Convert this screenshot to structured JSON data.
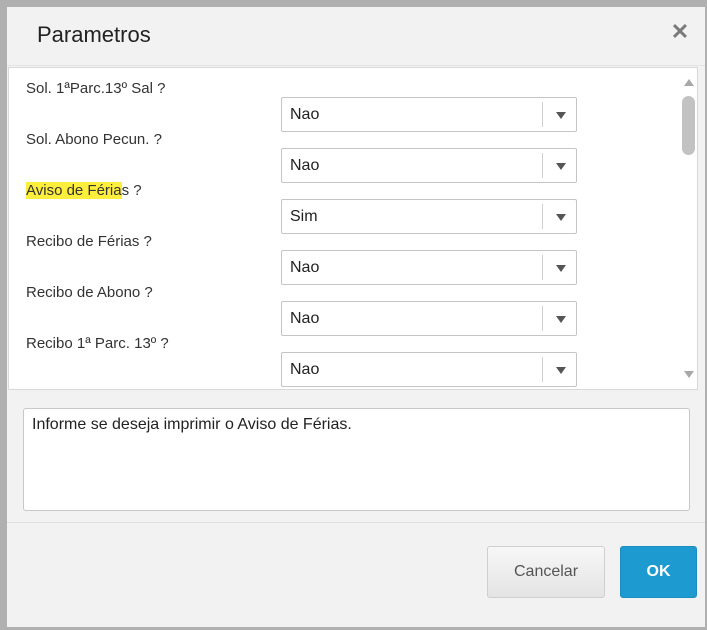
{
  "dialog": {
    "title": "Parametros",
    "close_icon": "close-icon"
  },
  "parameters": [
    {
      "label": "Sol. 1ªParc.13º Sal ?",
      "value": "Nao",
      "highlight": ""
    },
    {
      "label": "Sol. Abono Pecun. ?",
      "value": "Nao",
      "highlight": ""
    },
    {
      "label_highlight": "Aviso de Féria",
      "label_rest": "s ?",
      "value": "Sim"
    },
    {
      "label": "Recibo de Férias ?",
      "value": "Nao"
    },
    {
      "label": "Recibo de Abono ?",
      "value": "Nao"
    },
    {
      "label": "Recibo 1ª Parc. 13º ?",
      "value": "Nao"
    }
  ],
  "help": {
    "text": "Informe se deseja imprimir o Aviso de Férias."
  },
  "buttons": {
    "cancel": "Cancelar",
    "ok": "OK"
  },
  "colors": {
    "accent": "#1d9bd0",
    "highlight": "#ffef3d"
  }
}
